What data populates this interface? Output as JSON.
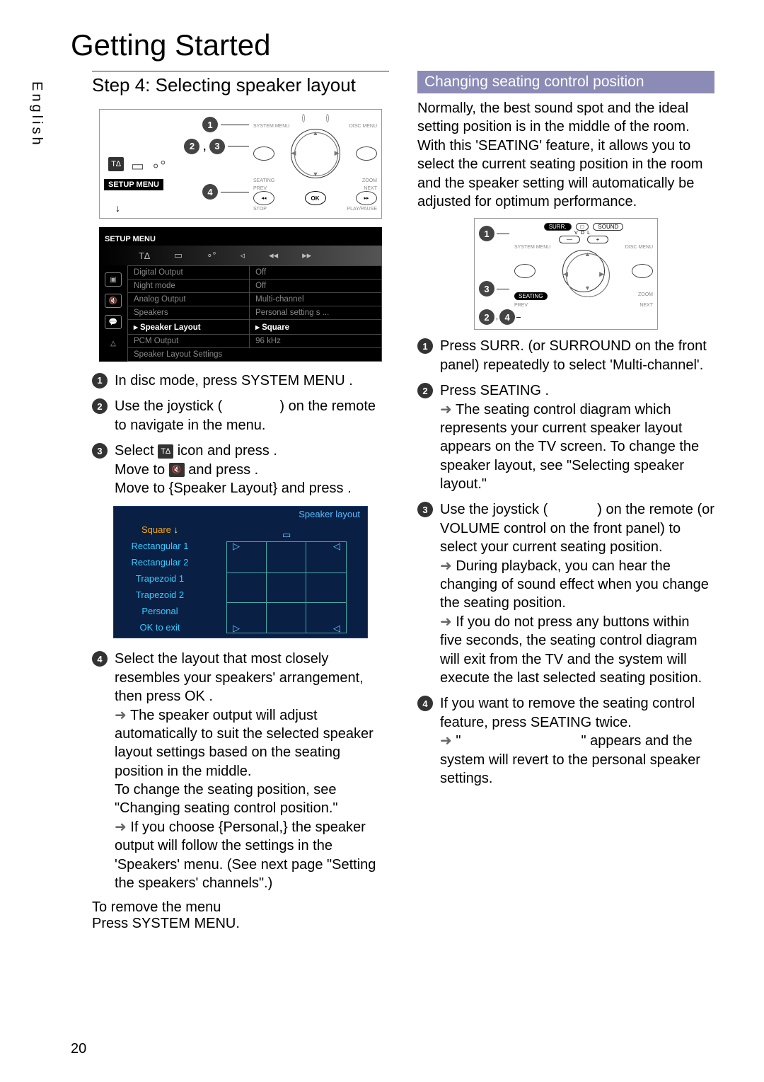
{
  "page_title": "Getting Started",
  "language": "English",
  "page_number": "20",
  "left": {
    "step_heading": "Step 4: Selecting speaker layout",
    "remote": {
      "callouts": [
        "1",
        "2",
        "3",
        "4"
      ],
      "top_labels": [
        "SYSTEM MENU",
        "DISC MENU"
      ],
      "mid_labels": [
        "SEATING",
        "ZOOM"
      ],
      "bottom_labels": [
        "PREV",
        "NEXT"
      ],
      "ok": "OK",
      "setup_menu": "SETUP MENU",
      "stop": "STOP",
      "play": "PLAY/PAUSE"
    },
    "osd": {
      "setup": "SETUP MENU",
      "tabs_icons": [
        "T∆",
        "▭",
        "∘°",
        "◃",
        "◂◂",
        "▸▸"
      ],
      "side_icons": [
        "▣",
        "🔇",
        "💬",
        "△"
      ],
      "rows": [
        {
          "k": "Digital Output",
          "v": "Off"
        },
        {
          "k": "Night mode",
          "v": "Off"
        },
        {
          "k": "Analog Output",
          "v": "Multi-channel"
        },
        {
          "k": "Speakers",
          "v": "Personal setting s ..."
        },
        {
          "k": "Speaker Layout",
          "v": "Square",
          "sel": true
        },
        {
          "k": "PCM Output",
          "v": "96 kHz"
        }
      ],
      "last_row": "Speaker Layout Settings"
    },
    "steps": {
      "s1": "In disc mode, press SYSTEM MENU .",
      "s2a": "Use the joystick (",
      "s2b": ") on the remote to navigate in the menu.",
      "s3a": "Select ",
      "s3b": " icon and press   .",
      "s3c": "Move to ",
      "s3d": " and press   .",
      "s3e": "Move to {Speaker Layout} and press   .",
      "s4a": "Select the layout that most closely resembles your speakers' arrangement, then press OK .",
      "s4b": "The speaker output will adjust automatically to suit the selected speaker layout settings based on the seating position in the middle.",
      "s4c": "To change the seating position, see \"Changing seating control position.\"",
      "s4d": "If you choose {Personal,} the speaker output will follow the settings in the 'Speakers' menu. (See next page \"Setting the speakers' channels\".)"
    },
    "layout": {
      "title": "Speaker layout",
      "options": [
        "Square",
        "Rectangular 1",
        "Rectangular 2",
        "Trapezoid 1",
        "Trapezoid 2",
        "Personal",
        "OK to exit"
      ]
    },
    "remove_title": "To remove the menu",
    "remove_sub": "Press SYSTEM MENU."
  },
  "right": {
    "section": "Changing seating control position",
    "intro": "Normally, the best sound spot and the ideal setting position is in the middle of the room.  With this 'SEATING' feature, it allows you to select the current seating position in the room and the speaker setting will automatically be adjusted for optimum performance.",
    "remote": {
      "c1": "1",
      "c3": "3",
      "c24": "2 , 4",
      "surr": "SURR.",
      "sq": "□",
      "sound": "SOUND",
      "vol": "VOL",
      "sysmenu": "SYSTEM MENU",
      "discmenu": "DISC MENU",
      "seating": "SEATING",
      "zoom": "ZOOM",
      "prev": "PREV",
      "next": "NEXT"
    },
    "steps": {
      "s1": "Press SURR. (or SURROUND   on the front panel) repeatedly to select 'Multi-channel'.",
      "s2a": "Press SEATING .",
      "s2b": "The seating control diagram which represents your current speaker layout appears on the TV screen.  To change the speaker layout, see \"Selecting speaker layout.\"",
      "s3a": "Use the joystick (",
      "s3b": ") on the remote (or VOLUME   control on the front panel) to select your current seating position.",
      "s3c": "During playback, you can hear the changing of sound effect when you change the seating position.",
      "s3d": "If you do not press any buttons within five seconds, the seating control diagram will exit from the TV and the system will execute the last selected seating position.",
      "s4a": "If you want to remove the seating control feature, press SEATING   twice.",
      "s4b_pre": "\"",
      "s4b_post": "\" appears and the system will revert to the personal speaker settings."
    }
  }
}
